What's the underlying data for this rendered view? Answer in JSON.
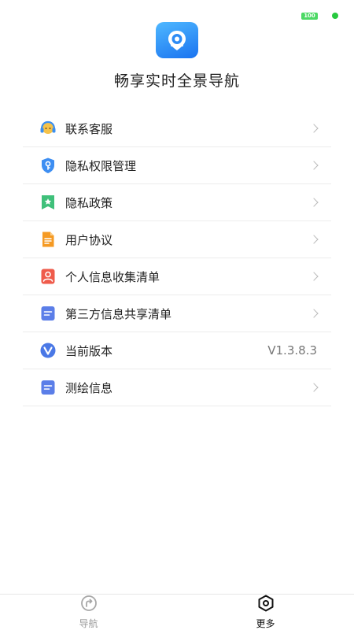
{
  "status_bar": {
    "battery": "100"
  },
  "app": {
    "title": "畅享实时全景导航"
  },
  "menu": {
    "items": [
      {
        "label": "联系客服",
        "icon": "headset-icon"
      },
      {
        "label": "隐私权限管理",
        "icon": "shield-key-icon"
      },
      {
        "label": "隐私政策",
        "icon": "bookmark-star-icon"
      },
      {
        "label": "用户协议",
        "icon": "document-icon"
      },
      {
        "label": "个人信息收集清单",
        "icon": "person-card-icon"
      },
      {
        "label": "第三方信息共享清单",
        "icon": "list-doc-icon"
      },
      {
        "label": "当前版本",
        "icon": "version-v-icon",
        "value": "V1.3.8.3"
      },
      {
        "label": "测绘信息",
        "icon": "list-doc-icon"
      }
    ]
  },
  "tabs": [
    {
      "label": "导航",
      "icon": "compass-arrow-icon",
      "active": false
    },
    {
      "label": "更多",
      "icon": "hexagon-settings-icon",
      "active": true
    }
  ],
  "colors": {
    "accent": "#1a73f0",
    "battery": "#4cd964",
    "divider": "#ececec"
  }
}
